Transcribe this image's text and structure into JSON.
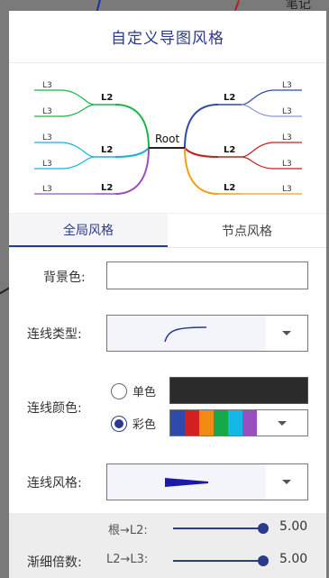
{
  "background": {
    "corner_text": "笔记"
  },
  "dialog": {
    "title": "自定义导图风格",
    "preview": {
      "root": "Root",
      "l2": "L2",
      "l3": "L3"
    },
    "tabs": [
      {
        "label": "全局风格",
        "active": true
      },
      {
        "label": "节点风格",
        "active": false
      }
    ],
    "background_color": {
      "label": "背景色:",
      "value": ""
    },
    "line_type": {
      "label": "连线类型:"
    },
    "line_color": {
      "label": "连线颜色:",
      "mono_label": "单色",
      "multi_label": "彩色",
      "selected": "multi",
      "mono_color": "#2b2b2b",
      "palette": [
        "#2f4aa8",
        "#d32020",
        "#f08a12",
        "#17a84a",
        "#14b7e6",
        "#9a4fc0"
      ]
    },
    "line_style": {
      "label": "连线风格:"
    },
    "taper": {
      "label": "渐细倍数:",
      "root_l2_label": "根→L2:",
      "root_l2_value": "5.00",
      "l2_l3_label": "L2→L3:",
      "l2_l3_value": "5.00"
    }
  }
}
